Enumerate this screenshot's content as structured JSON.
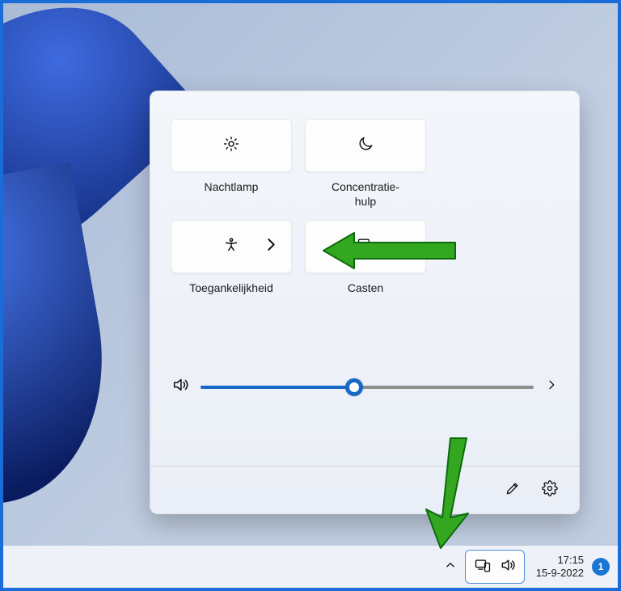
{
  "quick_settings": {
    "tiles": [
      {
        "name": "night-light",
        "label": "Nachtlamp"
      },
      {
        "name": "focus-assist",
        "label": "Concentratie-\nhulp"
      },
      {
        "name": "accessibility",
        "label": "Toegankelijkheid",
        "has_submenu": true
      },
      {
        "name": "cast",
        "label": "Casten"
      }
    ],
    "volume": {
      "value": 46,
      "min": 0,
      "max": 100
    }
  },
  "taskbar": {
    "time": "17:15",
    "date": "15-9-2022",
    "notification_count": "1"
  }
}
